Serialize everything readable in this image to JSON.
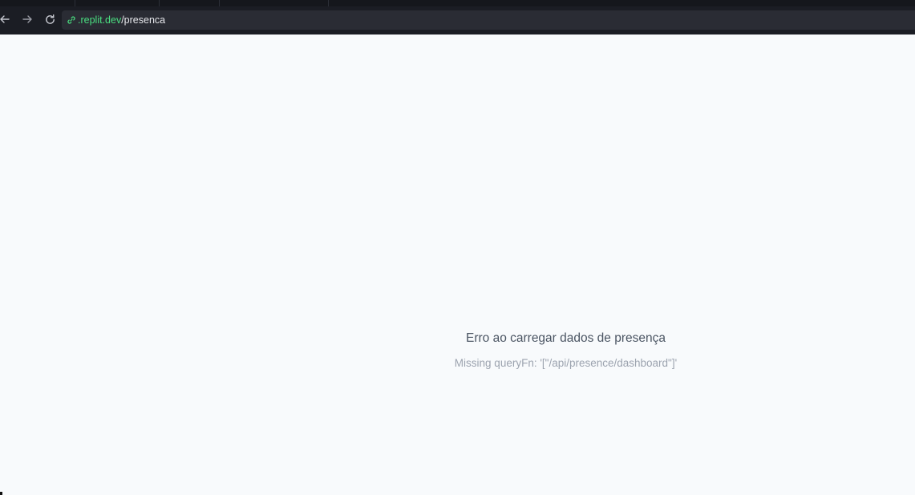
{
  "browser": {
    "url_domain": ".replit.dev",
    "url_path": "/presenca",
    "icons": {
      "back": "arrow-left-icon",
      "forward": "arrow-right-icon",
      "reload": "reload-icon",
      "site_info": "link-icon"
    },
    "colors": {
      "chrome_background": "#1b1d24",
      "address_bar": "#2a2c34",
      "domain_text": "#4ade80",
      "path_text": "#e6e7eb"
    }
  },
  "page": {
    "error_title": "Erro ao carregar dados de presença",
    "error_detail": "Missing queryFn: '[\"/api/presence/dashboard\"]'",
    "colors": {
      "background": "#f8fafc",
      "title_text": "#4b5563",
      "detail_text": "#9ca3af"
    }
  }
}
